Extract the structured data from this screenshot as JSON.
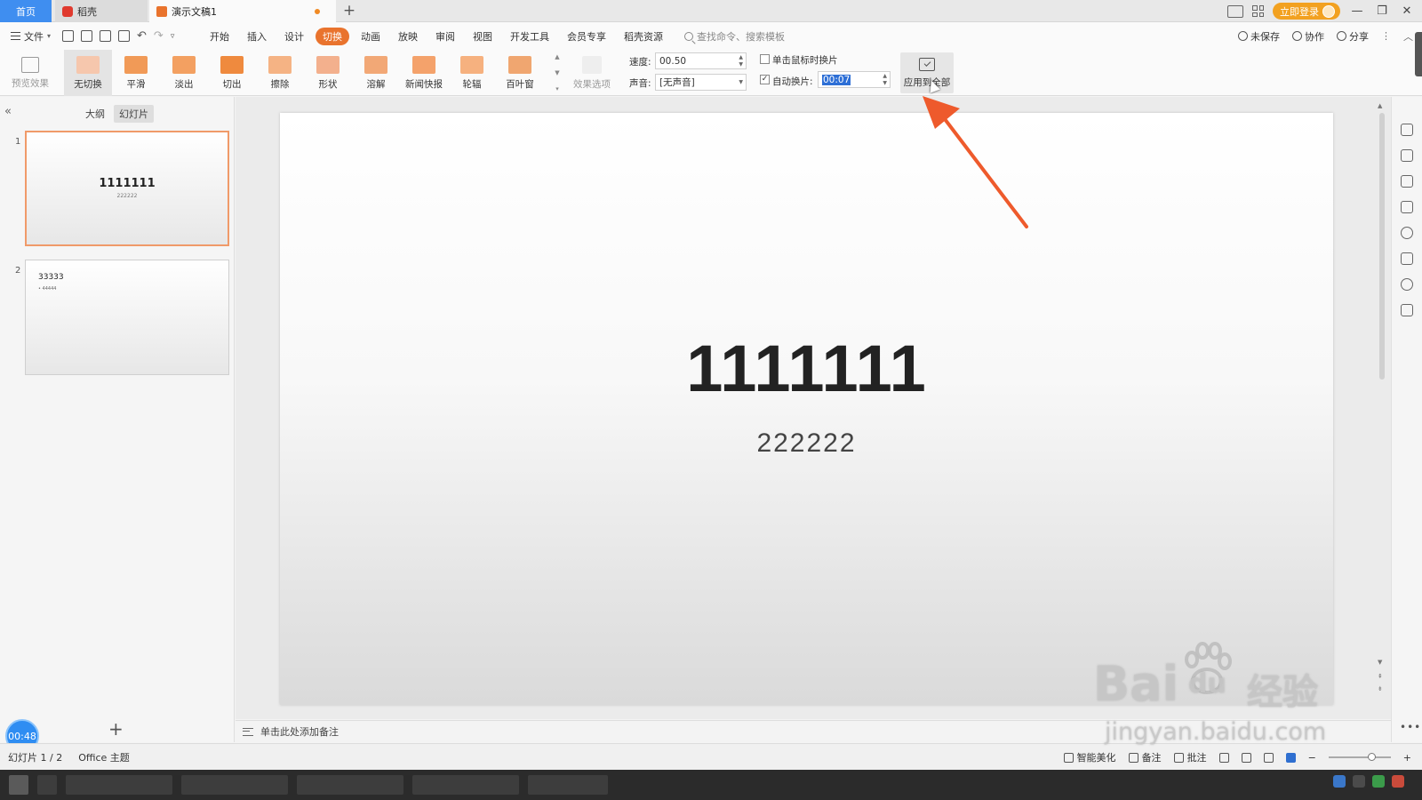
{
  "titlebar": {
    "tabs": [
      {
        "label": "首页",
        "active": true
      },
      {
        "label": "稻壳",
        "active": false
      },
      {
        "label": "演示文稿1",
        "active": false,
        "modified": true
      }
    ],
    "new_tab": "+",
    "login_label": "立即登录",
    "window_controls": [
      "—",
      "❐",
      "✕"
    ]
  },
  "menubar": {
    "file_label": "文件",
    "tabs": [
      "开始",
      "插入",
      "设计",
      "切换",
      "动画",
      "放映",
      "审阅",
      "视图",
      "开发工具",
      "会员专享",
      "稻壳资源"
    ],
    "active_tab": "切换",
    "search_placeholder": "查找命令、搜索模板",
    "right": {
      "unsaved": "未保存",
      "collab": "协作",
      "share": "分享"
    }
  },
  "ribbon": {
    "preview_label": "预览效果",
    "transitions": [
      {
        "label": "无切换",
        "color": "#f6c7ad",
        "selected": true
      },
      {
        "label": "平滑",
        "color": "#f19a57",
        "selected": false
      },
      {
        "label": "淡出",
        "color": "#f3a061",
        "selected": false
      },
      {
        "label": "切出",
        "color": "#ef8a3e",
        "selected": false
      },
      {
        "label": "擦除",
        "color": "#f5b384",
        "selected": false
      },
      {
        "label": "形状",
        "color": "#f3b08d",
        "selected": false
      },
      {
        "label": "溶解",
        "color": "#f2a876",
        "selected": false
      },
      {
        "label": "新闻快报",
        "color": "#f4a26b",
        "selected": false
      },
      {
        "label": "轮辐",
        "color": "#f6b17f",
        "selected": false
      },
      {
        "label": "百叶窗",
        "color": "#f0a670",
        "selected": false
      }
    ],
    "effect_options_label": "效果选项",
    "speed_label": "速度:",
    "speed_value": "00.50",
    "sound_label": "声音:",
    "sound_value": "[无声音]",
    "on_click_label": "单击鼠标时换片",
    "on_click_checked": false,
    "auto_label": "自动换片:",
    "auto_checked": true,
    "auto_value": "00:07",
    "apply_all_label": "应用到全部"
  },
  "leftpanel": {
    "tabs": [
      "大纲",
      "幻灯片"
    ],
    "active_tab": "幻灯片",
    "slides": [
      {
        "number": "1",
        "title": "1111111",
        "subtitle": "222222"
      },
      {
        "number": "2",
        "title": "33333",
        "subtitle": "• 44444"
      }
    ],
    "timer": "00:48",
    "add_label": "+"
  },
  "slide": {
    "title": "1111111",
    "subtitle": "222222"
  },
  "notes_placeholder": "单击此处添加备注",
  "statusbar": {
    "slide_counter": "幻灯片 1 / 2",
    "theme": "Office 主题",
    "beautify": "智能美化",
    "notes": "备注",
    "comments": "批注"
  },
  "watermark": {
    "brand": "Bai",
    "brand2": "du",
    "cn": "经验",
    "url": "jingyan.baidu.com"
  },
  "colors": {
    "accent": "#e9732d",
    "home_tab": "#3f8ef0",
    "login": "#f2a120",
    "arrow": "#ee5a2c"
  }
}
